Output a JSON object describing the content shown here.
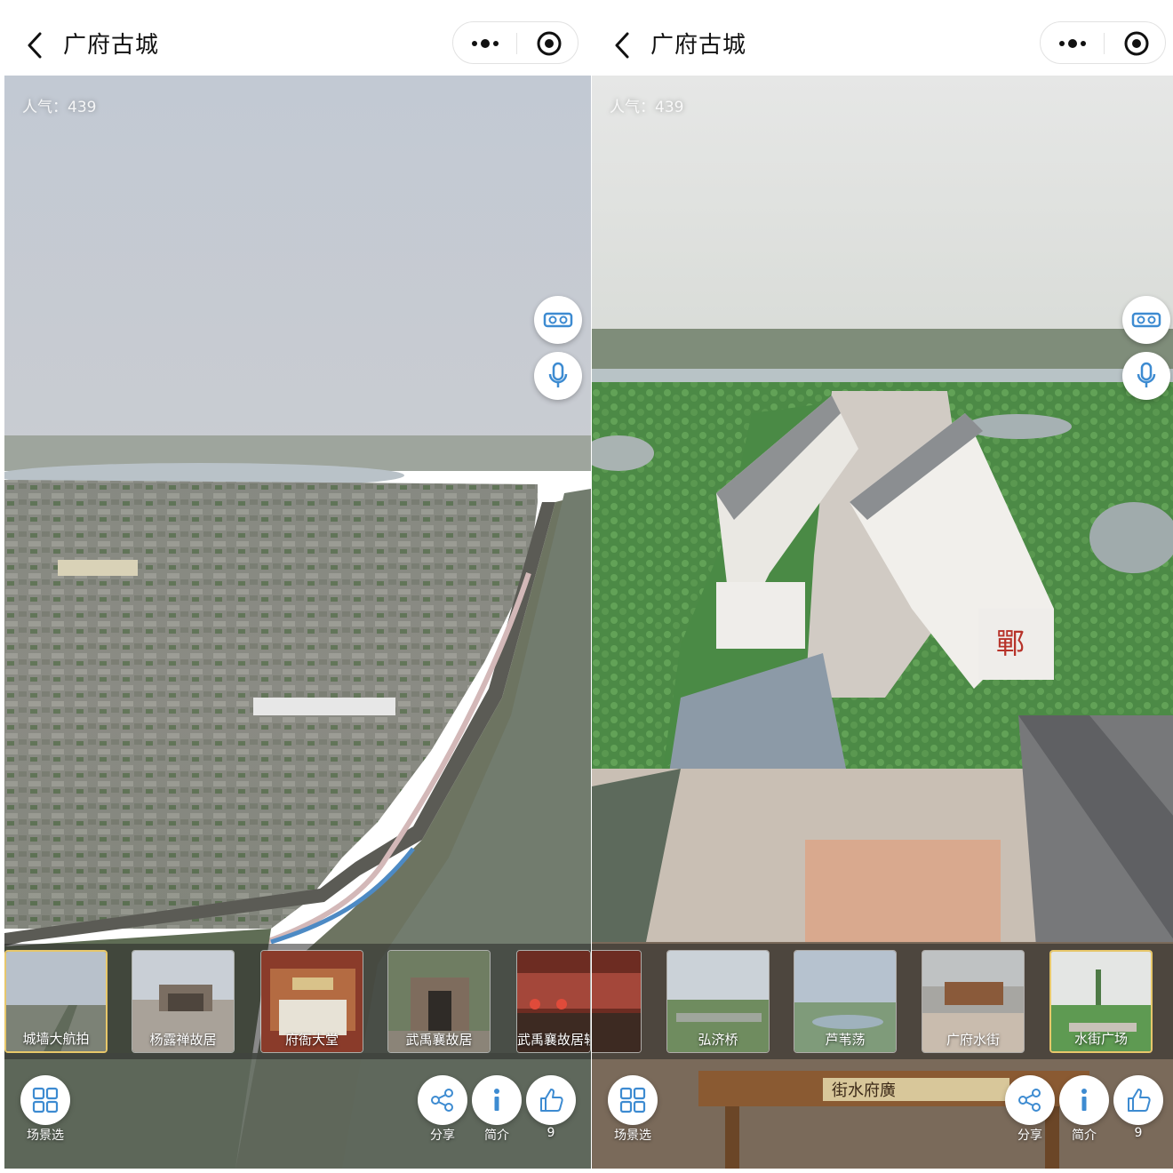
{
  "panels": [
    {
      "title": "广府古城",
      "popularity": "人气：439",
      "thumbs": [
        {
          "label": "城墙大航拍",
          "active": true
        },
        {
          "label": "杨露禅故居",
          "active": false
        },
        {
          "label": "府衙大堂",
          "active": false
        },
        {
          "label": "武禹襄故居",
          "active": false
        },
        {
          "label": "武禹襄故居轿房",
          "active": false
        }
      ],
      "actions": {
        "scenes": "场景选",
        "share": "分享",
        "intro": "简介",
        "likes": "9"
      }
    },
    {
      "title": "广府古城",
      "popularity": "人气：439",
      "thumbs": [
        {
          "label": "弘济桥",
          "active": false
        },
        {
          "label": "芦苇荡",
          "active": false
        },
        {
          "label": "广府水街",
          "active": false
        },
        {
          "label": "水街广场",
          "active": true
        }
      ],
      "actions": {
        "scenes": "场景选",
        "share": "分享",
        "intro": "简介",
        "likes": "9"
      },
      "sign_text": "街水府廣"
    }
  ],
  "icons": [
    "back-icon",
    "more-dots-icon",
    "target-icon",
    "vr-glasses-icon",
    "microphone-icon",
    "grid-icon",
    "share-icon",
    "info-icon",
    "thumbs-up-icon"
  ],
  "colors": {
    "accent": "#3d8bd1",
    "active_border": "#e7c76a"
  }
}
